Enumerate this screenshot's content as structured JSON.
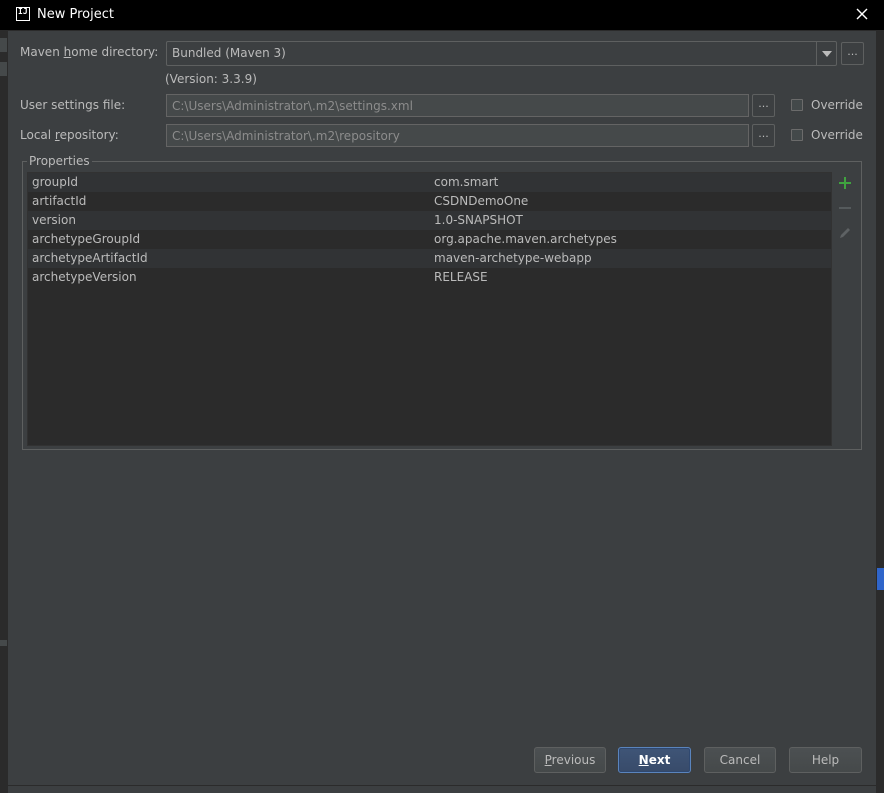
{
  "window": {
    "title": "New Project",
    "app_icon": "IJ"
  },
  "maven": {
    "home_label_pre": "Maven ",
    "home_label_ul": "h",
    "home_label_post": "ome directory:",
    "home_value": "Bundled (Maven 3)",
    "version_text": "(Version: 3.3.9)",
    "user_settings_label": "User settings file:",
    "user_settings_value": "C:\\Users\\Administrator\\.m2\\settings.xml",
    "local_repo_label_pre": "Local ",
    "local_repo_label_ul": "r",
    "local_repo_label_post": "epository:",
    "local_repo_value": "C:\\Users\\Administrator\\.m2\\repository",
    "browse_label": "...",
    "override_label": "Override"
  },
  "properties": {
    "title": "Properties",
    "rows": [
      {
        "key": "groupId",
        "value": "com.smart"
      },
      {
        "key": "artifactId",
        "value": "CSDNDemoOne"
      },
      {
        "key": "version",
        "value": "1.0-SNAPSHOT"
      },
      {
        "key": "archetypeGroupId",
        "value": "org.apache.maven.archetypes"
      },
      {
        "key": "archetypeArtifactId",
        "value": "maven-archetype-webapp"
      },
      {
        "key": "archetypeVersion",
        "value": "RELEASE"
      }
    ],
    "tools": [
      "add-icon",
      "remove-icon",
      "edit-icon"
    ]
  },
  "buttons": {
    "previous_ul": "P",
    "previous_rest": "revious",
    "next_ul": "N",
    "next_rest": "ext",
    "cancel": "Cancel",
    "help": "Help"
  },
  "colors": {
    "background": "#3c3f41",
    "table_bg": "#2b2b2b",
    "row_alt": "#313335",
    "text": "#bbbbbb",
    "add_green": "#3fa33f",
    "default_button": "#384b6a"
  }
}
